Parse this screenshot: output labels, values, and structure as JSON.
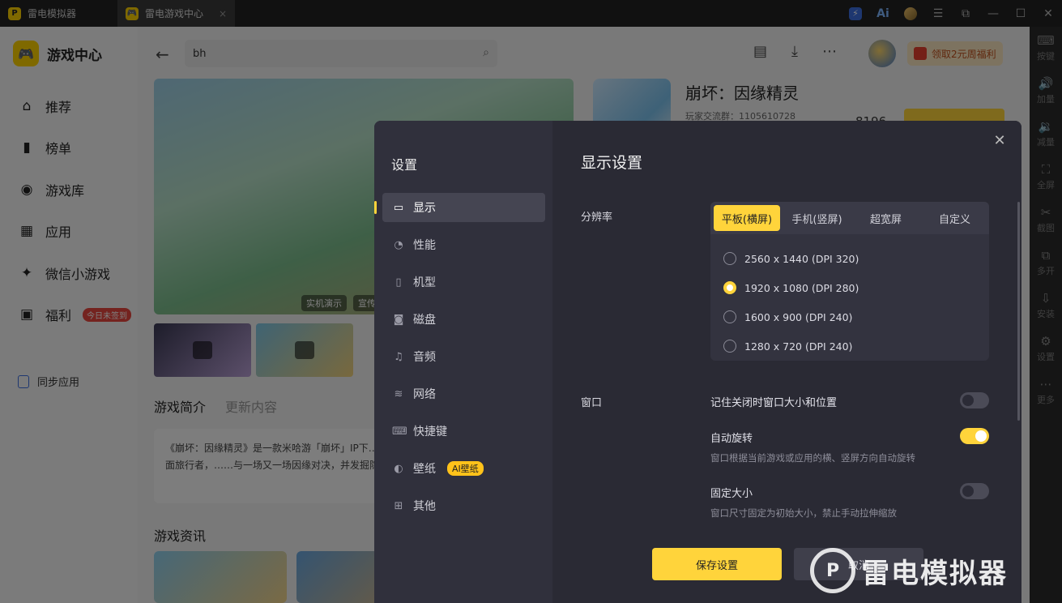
{
  "titlebar": {
    "tabs": [
      {
        "label": "雷电模拟器"
      },
      {
        "label": "雷电游戏中心",
        "close": "×"
      }
    ],
    "buttons": [
      "⚡",
      "Ai",
      "",
      "☰",
      "⧉",
      "—",
      "☐",
      "✕"
    ]
  },
  "sidebar": {
    "brand": "游戏中心",
    "items": [
      {
        "label": "推荐",
        "icon": "home-icon"
      },
      {
        "label": "榜单",
        "icon": "rank-icon"
      },
      {
        "label": "游戏库",
        "icon": "gamepad-icon"
      },
      {
        "label": "应用",
        "icon": "apps-icon"
      },
      {
        "label": "微信小游戏",
        "icon": "wechat-icon"
      },
      {
        "label": "福利",
        "icon": "gift-icon",
        "badge": "今日未签到"
      }
    ],
    "sync": "同步应用"
  },
  "main": {
    "search_value": "bh",
    "promo": "领取2元周福利",
    "game_title": "崩坏：因缘精灵",
    "game_sub": "玩家交流群：1105610728",
    "game_num": "8196",
    "hero_pills": [
      "实机演示",
      "宣传"
    ],
    "tabs": [
      "游戏简介",
      "更新内容"
    ],
    "intro": "《崩坏：因缘精灵》是一款米哈游「崩坏」IP下……中，您将扮演一位从幽禁中逃生的位面旅行者，……与一场又一场因缘对决，并发掘隐藏在自己过……",
    "news_title": "游戏资讯"
  },
  "rstrip": [
    {
      "label": "按键",
      "icon": "⌨"
    },
    {
      "label": "加量",
      "icon": "🔊"
    },
    {
      "label": "减量",
      "icon": "🔉"
    },
    {
      "label": "全屏",
      "icon": "⛶"
    },
    {
      "label": "截图",
      "icon": "✂"
    },
    {
      "label": "多开",
      "icon": "⧉"
    },
    {
      "label": "安装",
      "icon": "⇩"
    },
    {
      "label": "设置",
      "icon": "⚙"
    },
    {
      "label": "更多",
      "icon": "⋯"
    }
  ],
  "dialog": {
    "title": "设置",
    "menu": [
      {
        "label": "显示",
        "icon": "▭",
        "active": true
      },
      {
        "label": "性能",
        "icon": "◔"
      },
      {
        "label": "机型",
        "icon": "▯"
      },
      {
        "label": "磁盘",
        "icon": "◙"
      },
      {
        "label": "音频",
        "icon": "♫"
      },
      {
        "label": "网络",
        "icon": "≋"
      },
      {
        "label": "快捷键",
        "icon": "⌨"
      },
      {
        "label": "壁纸",
        "icon": "◐",
        "badge": "AI壁纸"
      },
      {
        "label": "其他",
        "icon": "⊞"
      }
    ],
    "heading": "显示设置",
    "resolution_label": "分辨率",
    "res_tabs": [
      "平板(横屏)",
      "手机(竖屏)",
      "超宽屏",
      "自定义"
    ],
    "res_options": [
      {
        "label": "2560 x 1440  (DPI 320)",
        "selected": false
      },
      {
        "label": "1920 x 1080  (DPI 280)",
        "selected": true
      },
      {
        "label": "1600 x 900  (DPI 240)",
        "selected": false
      },
      {
        "label": "1280 x 720  (DPI 240)",
        "selected": false
      }
    ],
    "window_label": "窗口",
    "window_rows": [
      {
        "title": "记住关闭时窗口大小和位置",
        "desc": "",
        "on": false
      },
      {
        "title": "自动旋转",
        "desc": "窗口根据当前游戏或应用的横、竖屏方向自动旋转",
        "on": true
      },
      {
        "title": "固定大小",
        "desc": "窗口尺寸固定为初始大小，禁止手动拉伸缩放",
        "on": false
      }
    ],
    "save": "保存设置",
    "cancel": "取消",
    "close": "✕"
  },
  "watermark": "雷电模拟器",
  "colors": {
    "accent": "#ffd43b",
    "dialog_bg": "#2a2a34"
  }
}
